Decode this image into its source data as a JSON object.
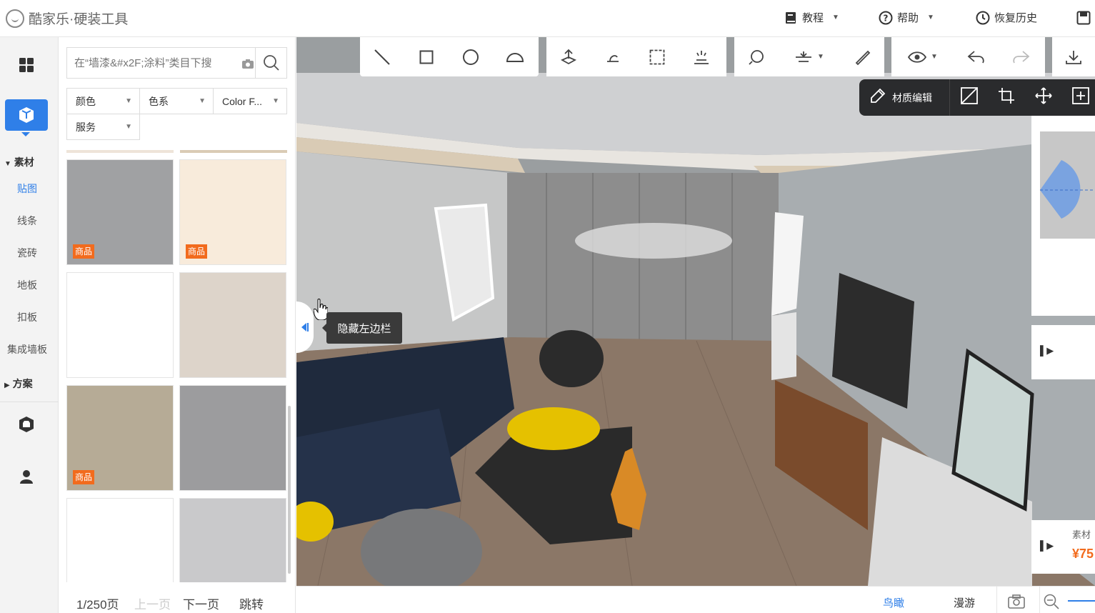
{
  "header": {
    "logo_text": "酷家乐·硬装工具",
    "menu": [
      {
        "label": "教程",
        "icon": "book-icon"
      },
      {
        "label": "帮助",
        "icon": "question-icon"
      },
      {
        "label": "恢复历史",
        "icon": "clock-icon"
      }
    ]
  },
  "rail": {
    "section_material": "素材",
    "items": [
      "贴图",
      "线条",
      "瓷砖",
      "地板",
      "扣板",
      "集成墙板"
    ],
    "active_item": "贴图",
    "section_plan": "方案"
  },
  "panel": {
    "search_placeholder": "在“墙漆&#x2F;涂料”类目下搜",
    "filters": [
      "颜色",
      "色系",
      "Color F...",
      "服务"
    ],
    "badge_label": "商品",
    "tiles": [
      {
        "color": "#a0a1a3",
        "badge": true
      },
      {
        "color": "#f8ebdb",
        "badge": true
      },
      {
        "color": "#ffffff",
        "badge": false
      },
      {
        "color": "#ddd4ca",
        "badge": false
      },
      {
        "color": "#b6ab96",
        "badge": true
      },
      {
        "color": "#9c9c9e",
        "badge": false
      },
      {
        "color": "#ffffff",
        "badge": false
      },
      {
        "color": "#c9c9cb",
        "badge": false
      }
    ],
    "pager": {
      "page_info": "1/250页",
      "prev": "上一页",
      "next": "下一页",
      "jump": "跳转"
    }
  },
  "viewport": {
    "material_edit_label": "材质编辑",
    "tooltip": "隐藏左边栏",
    "right_card": {
      "label": "素材",
      "price": "¥75"
    }
  },
  "bottom": {
    "view_aerial": "鸟瞰",
    "view_roam": "漫游"
  },
  "colors": {
    "accent": "#2f7fe8",
    "badge": "#f26b1d",
    "toolbar_dark": "#2a2b2d"
  }
}
